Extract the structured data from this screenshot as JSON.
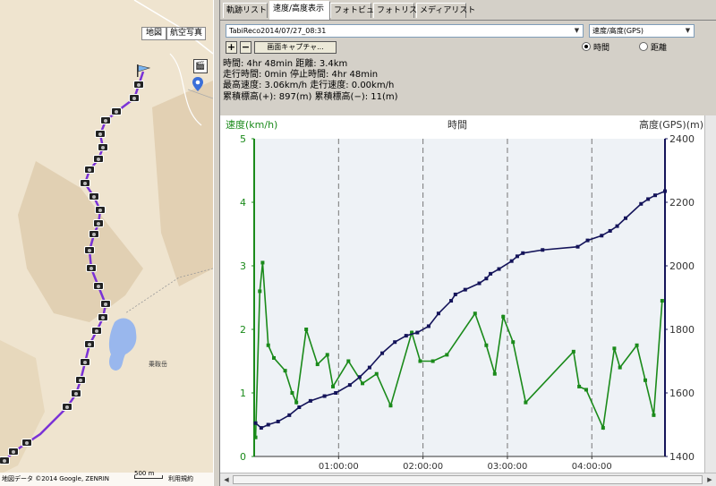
{
  "map": {
    "type_buttons": [
      "地図",
      "航空写真"
    ],
    "attribution": "地図データ ©2014 Google, ZENRIN",
    "scale": "500 m",
    "terms": "利用規約",
    "place_label": "乗鞍岳"
  },
  "tabs": [
    {
      "label": "軌跡リスト",
      "active": false
    },
    {
      "label": "速度/高度表示",
      "active": true
    },
    {
      "label": "フォトビュー",
      "active": false
    },
    {
      "label": "フォトリスト",
      "active": false
    },
    {
      "label": "メディアリスト",
      "active": false
    }
  ],
  "toolbar": {
    "track_select": "TabiReco2014/07/27_08:31",
    "mode_select": "速度/高度(GPS)",
    "zoom_in": "+",
    "zoom_out": "−",
    "capture_button": "画面キャプチャ...",
    "radio_time": "時間",
    "radio_distance": "距離",
    "selected": "time"
  },
  "summary": {
    "line1": "時間: 4hr 48min 距離: 3.4km",
    "line2": "走行時間: 0min 停止時間: 4hr 48min",
    "line3": "最高速度: 3.06km/h 走行速度: 0.00km/h",
    "line4": "累積標高(+): 897(m) 累積標高(−): 11(m)"
  },
  "colors": {
    "speed": "#1a8a1a",
    "altitude": "#14145a",
    "grid": "#777777",
    "chart_bg": "#eef2f6"
  },
  "chart_data": {
    "type": "line",
    "xlabel": "時間",
    "ylabel_left": "速度(km/h)",
    "ylabel_right": "高度(GPS)(m)",
    "x_ticks": [
      "01:00:00",
      "02:00:00",
      "03:00:00",
      "04:00:00"
    ],
    "x_tick_values": [
      60,
      120,
      180,
      240
    ],
    "xlim": [
      0,
      292
    ],
    "y_left_ticks": [
      "0",
      "1",
      "2",
      "3",
      "4",
      "5"
    ],
    "y_left_lim": [
      0,
      5
    ],
    "y_right_ticks": [
      "1400",
      "1600",
      "1800",
      "2000",
      "2200",
      "2400"
    ],
    "y_right_lim": [
      1400,
      2400
    ],
    "grid": "vertical dashed",
    "series": [
      {
        "name": "速度",
        "axis": "left",
        "points": [
          [
            1,
            0.3
          ],
          [
            4,
            2.6
          ],
          [
            6,
            3.05
          ],
          [
            10,
            1.75
          ],
          [
            14,
            1.55
          ],
          [
            22,
            1.35
          ],
          [
            27,
            1.0
          ],
          [
            30,
            0.85
          ],
          [
            37,
            2.0
          ],
          [
            45,
            1.45
          ],
          [
            52,
            1.6
          ],
          [
            56,
            1.1
          ],
          [
            67,
            1.5
          ],
          [
            77,
            1.15
          ],
          [
            87,
            1.3
          ],
          [
            97,
            0.8
          ],
          [
            112,
            1.95
          ],
          [
            118,
            1.5
          ],
          [
            127,
            1.5
          ],
          [
            137,
            1.6
          ],
          [
            157,
            2.25
          ],
          [
            165,
            1.75
          ],
          [
            171,
            1.3
          ],
          [
            177,
            2.2
          ],
          [
            184,
            1.8
          ],
          [
            193,
            0.85
          ],
          [
            227,
            1.65
          ],
          [
            231,
            1.1
          ],
          [
            236,
            1.05
          ],
          [
            248,
            0.45
          ],
          [
            256,
            1.7
          ],
          [
            260,
            1.4
          ],
          [
            272,
            1.75
          ],
          [
            278,
            1.2
          ],
          [
            284,
            0.65
          ],
          [
            290,
            2.45
          ]
        ]
      },
      {
        "name": "高度",
        "axis": "right",
        "points": [
          [
            1,
            1505
          ],
          [
            5,
            1490
          ],
          [
            10,
            1500
          ],
          [
            17,
            1510
          ],
          [
            25,
            1530
          ],
          [
            32,
            1555
          ],
          [
            40,
            1575
          ],
          [
            50,
            1590
          ],
          [
            58,
            1600
          ],
          [
            68,
            1625
          ],
          [
            75,
            1650
          ],
          [
            82,
            1680
          ],
          [
            91,
            1725
          ],
          [
            100,
            1760
          ],
          [
            108,
            1780
          ],
          [
            116,
            1790
          ],
          [
            124,
            1810
          ],
          [
            131,
            1850
          ],
          [
            140,
            1890
          ],
          [
            143,
            1910
          ],
          [
            150,
            1925
          ],
          [
            160,
            1945
          ],
          [
            165,
            1960
          ],
          [
            168,
            1975
          ],
          [
            174,
            1990
          ],
          [
            183,
            2015
          ],
          [
            187,
            2030
          ],
          [
            191,
            2040
          ],
          [
            205,
            2050
          ],
          [
            230,
            2060
          ],
          [
            237,
            2080
          ],
          [
            247,
            2095
          ],
          [
            253,
            2110
          ],
          [
            258,
            2125
          ],
          [
            264,
            2150
          ],
          [
            275,
            2195
          ],
          [
            280,
            2210
          ],
          [
            285,
            2222
          ],
          [
            292,
            2235
          ]
        ]
      }
    ]
  }
}
